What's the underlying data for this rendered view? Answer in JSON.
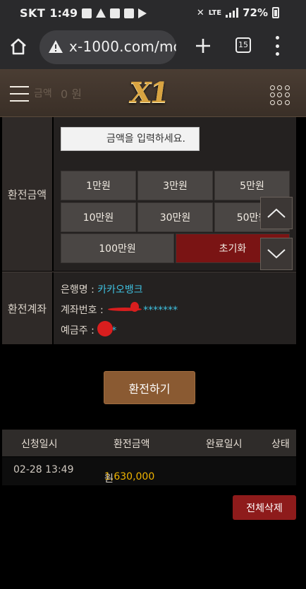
{
  "status_bar": {
    "carrier": "SKT",
    "time": "1:49",
    "network": "LTE",
    "battery": "72%"
  },
  "browser": {
    "url": "x-1000.com/mo",
    "tab_count": "15"
  },
  "header": {
    "logo": "X1",
    "ghost_label": "금액",
    "ghost_value": "0 원"
  },
  "form": {
    "amount_label": "환전금액",
    "amount_placeholder": "금액을 입력하세요.",
    "amount_buttons": [
      "1만원",
      "3만원",
      "5만원",
      "10만원",
      "30만원",
      "50만원",
      "100만원"
    ],
    "reset_label": "초기화",
    "account_label": "환전계좌",
    "bank_name_label": "은행명 :",
    "bank_name_value": "카카오뱅크",
    "account_number_label": "계좌번호 :",
    "account_number_value": "*******",
    "holder_label": "예금주 :",
    "holder_value": "*"
  },
  "exchange_button": "환전하기",
  "history": {
    "columns": [
      "신청일시",
      "환전금액",
      "완료일시",
      "상태"
    ],
    "rows": [
      {
        "requested": "02-28 13:49",
        "amount": "1,630,000",
        "unit": "원",
        "completed": "",
        "status": ""
      }
    ]
  },
  "delete_all_button": "전체삭제",
  "colors": {
    "accent_brown": "#8a5a32",
    "danger_red": "#7a1414",
    "link_blue": "#3fc1e0",
    "amount_yellow": "#f0b400"
  }
}
